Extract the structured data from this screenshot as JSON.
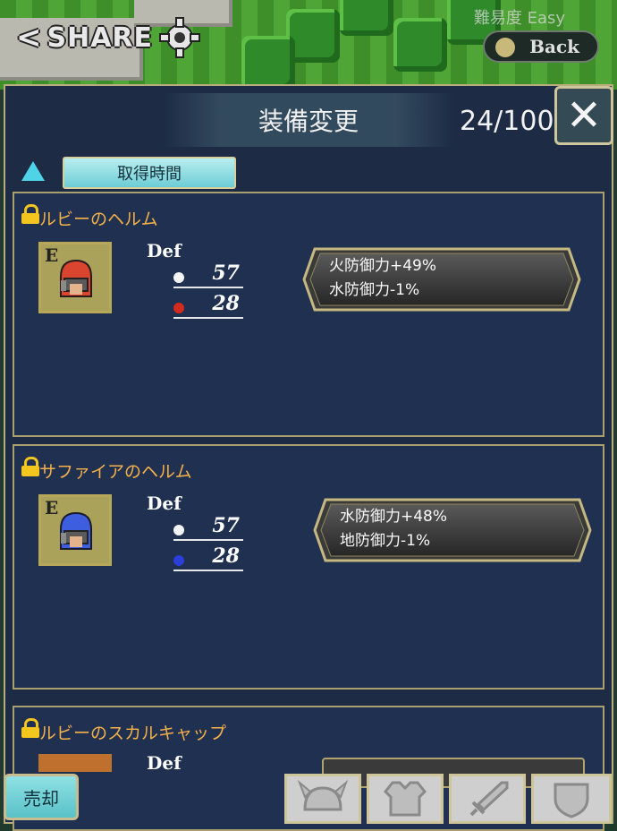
{
  "top": {
    "share_label": "SHARE",
    "difficulty": "難易度 Easy",
    "back_label": "Back"
  },
  "panel": {
    "title": "装備変更",
    "count": "24/100",
    "sort_label": "取得時間"
  },
  "items": [
    {
      "name": "ルビーのヘルム",
      "equipped_mark": "E",
      "stat_label": "Def",
      "stat_white": "57",
      "stat_colored": "28",
      "stat_color": "#d42a20",
      "helm_color": "#d9452e",
      "effects": [
        "火防御力+49%",
        "水防御力-1%"
      ]
    },
    {
      "name": "サファイアのヘルム",
      "equipped_mark": "E",
      "stat_label": "Def",
      "stat_white": "57",
      "stat_colored": "28",
      "stat_color": "#2b3fd8",
      "helm_color": "#3e5ee0",
      "effects": [
        "水防御力+48%",
        "地防御力-1%"
      ]
    },
    {
      "name": "ルビーのスカルキャップ",
      "stat_label": "Def"
    }
  ],
  "bottom": {
    "sell_label": "売却",
    "tabs": [
      "helmet-icon",
      "armor-icon",
      "sword-icon",
      "shield-icon"
    ]
  }
}
